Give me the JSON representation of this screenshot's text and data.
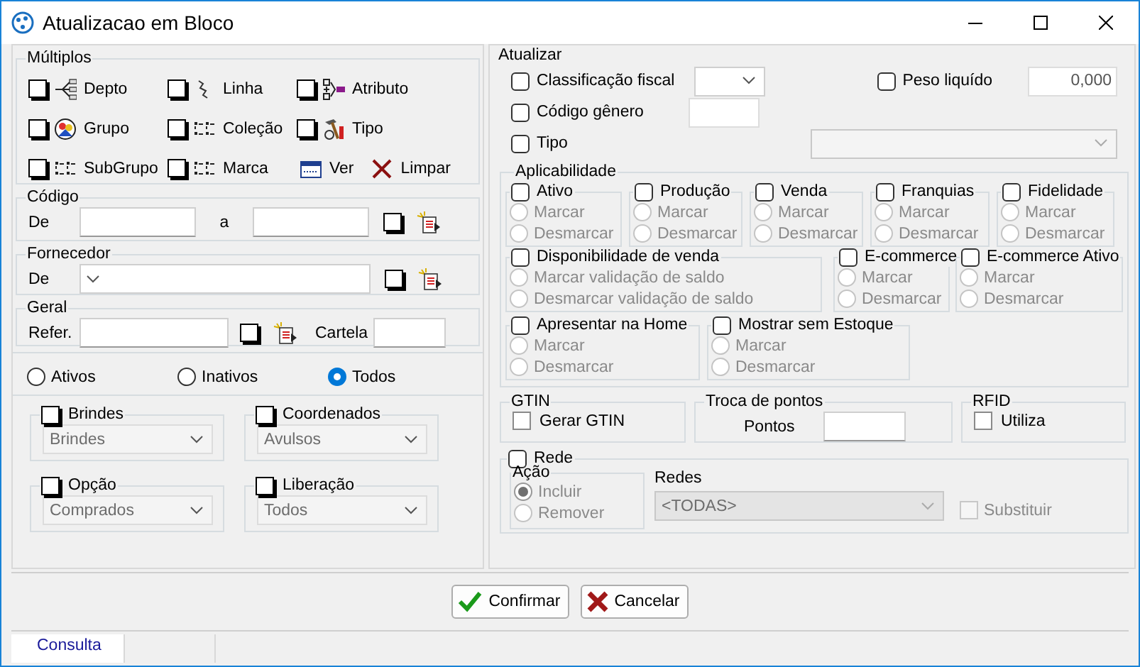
{
  "window": {
    "title": "Atualizacao em Bloco"
  },
  "multiplos": {
    "title": "Múltiplos",
    "items": [
      {
        "kind": "check",
        "label": "Depto",
        "checked": false
      },
      {
        "kind": "check",
        "label": "Linha",
        "checked": false
      },
      {
        "kind": "check",
        "label": "Atributo",
        "checked": false
      },
      {
        "kind": "check",
        "label": "Grupo",
        "checked": false
      },
      {
        "kind": "check",
        "label": "Coleção",
        "checked": false
      },
      {
        "kind": "check",
        "label": "Tipo",
        "checked": false
      },
      {
        "kind": "check",
        "label": "SubGrupo",
        "checked": false
      },
      {
        "kind": "check",
        "label": "Marca",
        "checked": false
      },
      {
        "kind": "action",
        "label": "Ver"
      },
      {
        "kind": "action",
        "label": "Limpar"
      }
    ]
  },
  "codigo": {
    "title": "Código",
    "from_label": "De",
    "to_label": "a",
    "checked": false
  },
  "fornecedor": {
    "title": "Fornecedor",
    "from_label": "De",
    "checked": false
  },
  "geral": {
    "title": "Geral",
    "ref_label": "Refer.",
    "checked": false,
    "cartela_label": "Cartela"
  },
  "status_filter": [
    {
      "label": "Ativos",
      "selected": false
    },
    {
      "label": "Inativos",
      "selected": false
    },
    {
      "label": "Todos",
      "selected": true
    }
  ],
  "filters": [
    {
      "label": "Brindes",
      "checked": false,
      "value": "Brindes",
      "disabled": true
    },
    {
      "label": "Coordenados",
      "checked": false,
      "value": "Avulsos",
      "disabled": true
    },
    {
      "label": "Opção",
      "checked": false,
      "value": "Comprados",
      "disabled": true
    },
    {
      "label": "Liberação",
      "checked": false,
      "value": "Todos",
      "disabled": true
    }
  ],
  "atualizar": {
    "title": "Atualizar",
    "fields": [
      {
        "kind": "dropdown",
        "label": "Classificação fiscal",
        "checked": false
      },
      {
        "kind": "text",
        "label": "Código gênero",
        "checked": false
      },
      {
        "kind": "wide-dropdown",
        "label": "Tipo",
        "checked": false
      }
    ],
    "peso": {
      "label": "Peso liquído",
      "checked": false,
      "value": "0,000"
    }
  },
  "aplicabilidade": {
    "title": "Aplicabilidade",
    "groups": [
      {
        "label": "Ativo",
        "checked": false,
        "disabled": true,
        "options": [
          {
            "label": "Marcar",
            "selected": false
          },
          {
            "label": "Desmarcar",
            "selected": false
          }
        ]
      },
      {
        "label": "Produção",
        "checked": false,
        "disabled": true,
        "options": [
          {
            "label": "Marcar",
            "selected": false
          },
          {
            "label": "Desmarcar",
            "selected": false
          }
        ]
      },
      {
        "label": "Venda",
        "checked": false,
        "disabled": true,
        "options": [
          {
            "label": "Marcar",
            "selected": false
          },
          {
            "label": "Desmarcar",
            "selected": false
          }
        ]
      },
      {
        "label": "Franquias",
        "checked": false,
        "disabled": true,
        "options": [
          {
            "label": "Marcar",
            "selected": false
          },
          {
            "label": "Desmarcar",
            "selected": false
          }
        ]
      },
      {
        "label": "Fidelidade",
        "checked": false,
        "disabled": true,
        "options": [
          {
            "label": "Marcar",
            "selected": false
          },
          {
            "label": "Desmarcar",
            "selected": false
          }
        ]
      },
      {
        "label": "Disponibilidade de venda",
        "checked": false,
        "disabled": true,
        "options": [
          {
            "label": "Marcar validação de saldo",
            "selected": false
          },
          {
            "label": "Desmarcar validação de saldo",
            "selected": false
          }
        ]
      },
      {
        "label": "E-commerce",
        "checked": false,
        "disabled": true,
        "options": [
          {
            "label": "Marcar",
            "selected": false
          },
          {
            "label": "Desmarcar",
            "selected": false
          }
        ]
      },
      {
        "label": "E-commerce Ativo",
        "checked": false,
        "disabled": true,
        "options": [
          {
            "label": "Marcar",
            "selected": false
          },
          {
            "label": "Desmarcar",
            "selected": false
          }
        ]
      },
      {
        "label": "Apresentar na Home",
        "checked": false,
        "disabled": true,
        "options": [
          {
            "label": "Marcar",
            "selected": false
          },
          {
            "label": "Desmarcar",
            "selected": false
          }
        ]
      },
      {
        "label": "Mostrar sem Estoque",
        "checked": false,
        "disabled": true,
        "options": [
          {
            "label": "Marcar",
            "selected": false
          },
          {
            "label": "Desmarcar",
            "selected": false
          }
        ]
      }
    ]
  },
  "gtin": {
    "title": "GTIN",
    "label": "Gerar GTIN",
    "checked": false
  },
  "troca_de_pontos": {
    "title": "Troca de pontos",
    "label": "Pontos"
  },
  "rfid": {
    "title": "RFID",
    "label": "Utiliza",
    "checked": false
  },
  "rede": {
    "label": "Rede",
    "checked": false,
    "acao": {
      "title": "Ação",
      "disabled": true,
      "options": [
        {
          "label": "Incluir",
          "selected": true
        },
        {
          "label": "Remover",
          "selected": false
        }
      ]
    },
    "redes": {
      "label": "Redes",
      "value": "<TODAS>",
      "disabled": true
    },
    "substituir": {
      "label": "Substituir",
      "checked": false,
      "disabled": true
    }
  },
  "buttons": [
    {
      "kind": "confirm",
      "label": "Confirmar"
    },
    {
      "kind": "cancel",
      "label": "Cancelar"
    }
  ],
  "status_bar": {
    "panels": [
      {
        "label": "Consulta"
      }
    ]
  }
}
